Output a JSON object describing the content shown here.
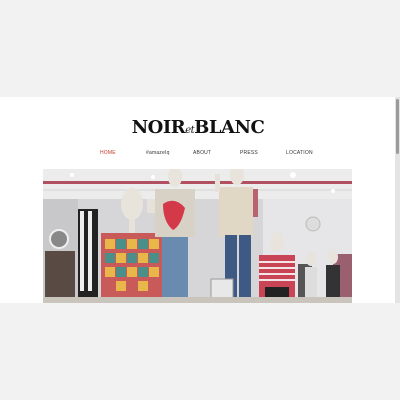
{
  "logo": {
    "part1": "NOIR",
    "connector": "et",
    "part2": "BLANC"
  },
  "nav": {
    "items": [
      {
        "label": "HOME",
        "active": true
      },
      {
        "label": "#amazeIq"
      },
      {
        "label": "ABOUT"
      },
      {
        "label": "PRESS"
      },
      {
        "label": "LOCATION"
      }
    ]
  },
  "hero": {
    "description_icon": "store-photo"
  },
  "colors": {
    "active_nav": "#c0392b",
    "text": "#111111",
    "background": "#f2f2f2"
  }
}
